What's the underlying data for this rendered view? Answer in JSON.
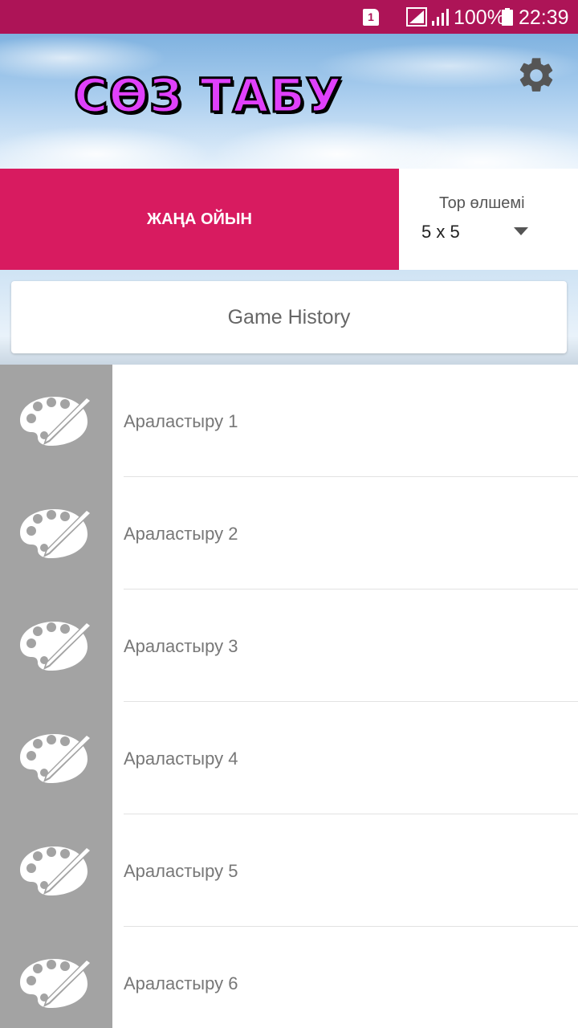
{
  "status_bar": {
    "sim_slot": "1",
    "battery_percent": "100%",
    "time": "22:39",
    "bar_color": "#ad1457"
  },
  "header": {
    "logo_text": "СӨЗ ТАБУ",
    "settings_icon": "gear-icon"
  },
  "actions": {
    "new_game_label": "ЖАҢА ОЙЫН",
    "new_game_color": "#d81b60",
    "grid_size_label": "Тор өлшемі",
    "grid_size_value": "5 x 5"
  },
  "history_button": "Game History",
  "list": {
    "icon": "palette-icon",
    "items": [
      {
        "label": "Араластыру 1"
      },
      {
        "label": "Араластыру 2"
      },
      {
        "label": "Араластыру 3"
      },
      {
        "label": "Араластыру 4"
      },
      {
        "label": "Араластыру 5"
      },
      {
        "label": "Араластыру 6"
      }
    ]
  }
}
